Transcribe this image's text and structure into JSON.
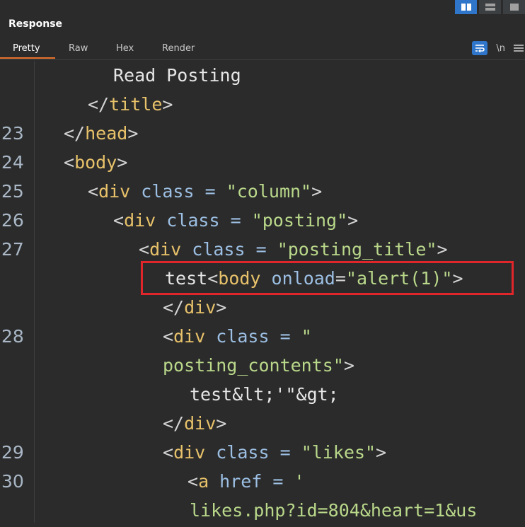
{
  "panel": {
    "title": "Response"
  },
  "tabs": [
    {
      "label": "Pretty",
      "active": true
    },
    {
      "label": "Raw",
      "active": false
    },
    {
      "label": "Hex",
      "active": false
    },
    {
      "label": "Render",
      "active": false
    }
  ],
  "tools": {
    "newline_label": "\\n"
  },
  "colors": {
    "accent": "#2f75c9",
    "tab_underline": "#e8742e",
    "highlight_border": "#e0262b",
    "tag": "#e8c26a",
    "string": "#b9d88a",
    "attribute": "#9cbfe3"
  },
  "code_lines": [
    {
      "num": "",
      "parts": [
        "Read Posting"
      ]
    },
    {
      "num": "",
      "parts": [
        "</",
        "title",
        ">"
      ]
    },
    {
      "num": "23",
      "parts": [
        "</",
        "head",
        ">"
      ]
    },
    {
      "num": "24",
      "parts": [
        "<",
        "body",
        ">"
      ]
    },
    {
      "num": "25",
      "parts": [
        "<",
        "div",
        " class = ",
        "\"column\"",
        ">"
      ]
    },
    {
      "num": "26",
      "parts": [
        "<",
        "div",
        " class = ",
        "\"posting\"",
        ">"
      ]
    },
    {
      "num": "27",
      "parts": [
        "<",
        "div",
        " class = ",
        "\"posting_title\"",
        ">"
      ]
    },
    {
      "num": "",
      "parts": [
        "test",
        "<",
        "body",
        " onload",
        "=",
        "\"alert(1)\"",
        ">"
      ]
    },
    {
      "num": "",
      "parts": [
        "</",
        "div",
        ">"
      ]
    },
    {
      "num": "28",
      "parts": [
        "<",
        "div",
        " class = ",
        "\""
      ]
    },
    {
      "num": "",
      "parts": [
        "posting_contents\"",
        ">"
      ]
    },
    {
      "num": "",
      "parts": [
        "test&lt;'\"&gt;"
      ]
    },
    {
      "num": "",
      "parts": [
        "</",
        "div",
        ">"
      ]
    },
    {
      "num": "29",
      "parts": [
        "<",
        "div",
        " class = ",
        "\"likes\"",
        ">"
      ]
    },
    {
      "num": "30",
      "parts": [
        "<",
        "a",
        " href = ",
        "'"
      ]
    },
    {
      "num": "",
      "parts": [
        "likes.php?id=804&heart=1&us"
      ]
    }
  ]
}
